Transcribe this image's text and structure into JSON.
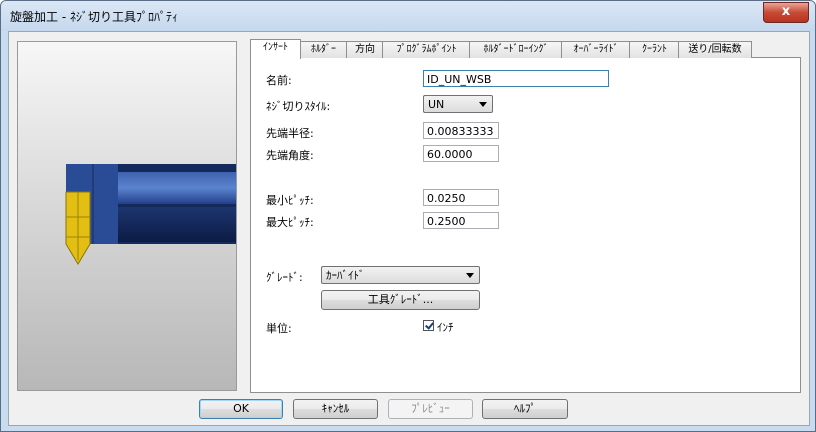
{
  "window": {
    "title": "旋盤加工 - ﾈｼﾞ切り工具ﾌﾟﾛﾊﾟﾃｨ",
    "close_glyph": "x"
  },
  "tabs": [
    {
      "label": "ｲﾝｻｰﾄ"
    },
    {
      "label": "ﾎﾙﾀﾞｰ"
    },
    {
      "label": "方向"
    },
    {
      "label": "ﾌﾟﾛｸﾞﾗﾑﾎﾟｲﾝﾄ"
    },
    {
      "label": "ﾎﾙﾀﾞｰﾄﾞﾛｰｲﾝｸﾞ"
    },
    {
      "label": "ｵｰﾊﾞｰﾗｲﾄﾞ"
    },
    {
      "label": "ｸｰﾗﾝﾄ"
    },
    {
      "label": "送り/回転数"
    }
  ],
  "form": {
    "name_label": "名前:",
    "name_value": "ID_UN_WSB",
    "thread_style_label": "ﾈｼﾞ切りｽﾀｲﾙ:",
    "thread_style_value": "UN",
    "tip_radius_label": "先端半径:",
    "tip_radius_value": "0.00833333",
    "tip_angle_label": "先端角度:",
    "tip_angle_value": "60.0000",
    "min_pitch_label": "最小ﾋﾟｯﾁ:",
    "min_pitch_value": "0.0250",
    "max_pitch_label": "最大ﾋﾟｯﾁ:",
    "max_pitch_value": "0.2500",
    "grade_label": "ｸﾞﾚｰﾄﾞ:",
    "grade_value": "ｶｰﾊﾞｲﾄﾞ",
    "tool_grade_button": "工具ｸﾞﾚｰﾄﾞ...",
    "unit_label": "単位:",
    "unit_checkbox_label": "ｲﾝﾁ",
    "unit_checked": true
  },
  "buttons": {
    "ok": "OK",
    "cancel": "ｷｬﾝｾﾙ",
    "preview": "ﾌﾟﾚﾋﾞｭｰ",
    "help": "ﾍﾙﾌﾟ"
  },
  "colors": {
    "insert": "#e2bf12",
    "holder": "#1f3a78",
    "holder_light": "#4f76c4"
  }
}
